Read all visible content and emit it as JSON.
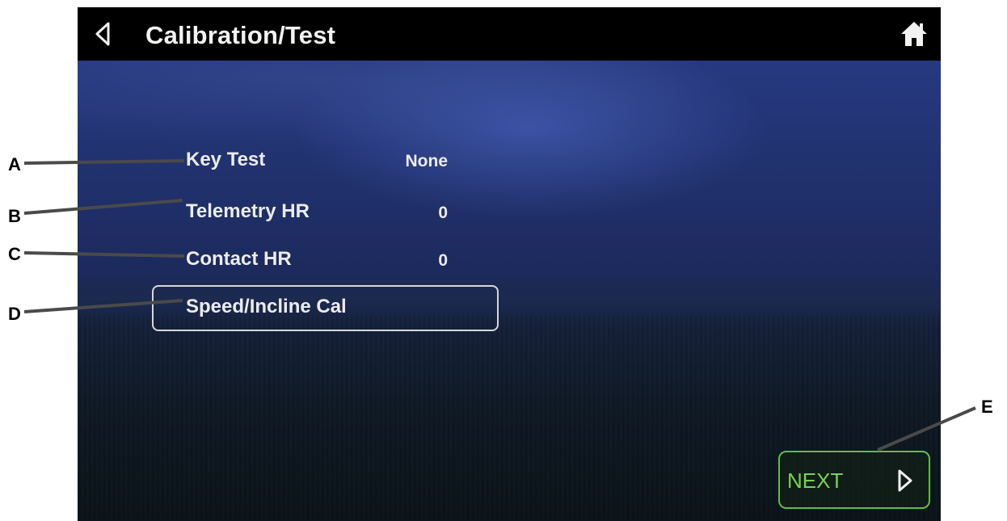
{
  "header": {
    "title": "Calibration/Test",
    "back_icon": "back-triangle-icon",
    "home_icon": "home-icon"
  },
  "rows": [
    {
      "label": "Key Test",
      "value": "None"
    },
    {
      "label": "Telemetry HR",
      "value": "0"
    },
    {
      "label": "Contact HR",
      "value": "0"
    }
  ],
  "calibration_button": {
    "label": "Speed/Incline Cal"
  },
  "next_button": {
    "label": "NEXT",
    "icon": "next-triangle-icon"
  },
  "callouts": [
    "A",
    "B",
    "C",
    "D",
    "E"
  ],
  "colors": {
    "titlebar": "#000000",
    "text": "#ececec",
    "next_accent": "#79d24e",
    "next_border": "#5fbf3f",
    "callout_line": "#4a4a4a"
  }
}
